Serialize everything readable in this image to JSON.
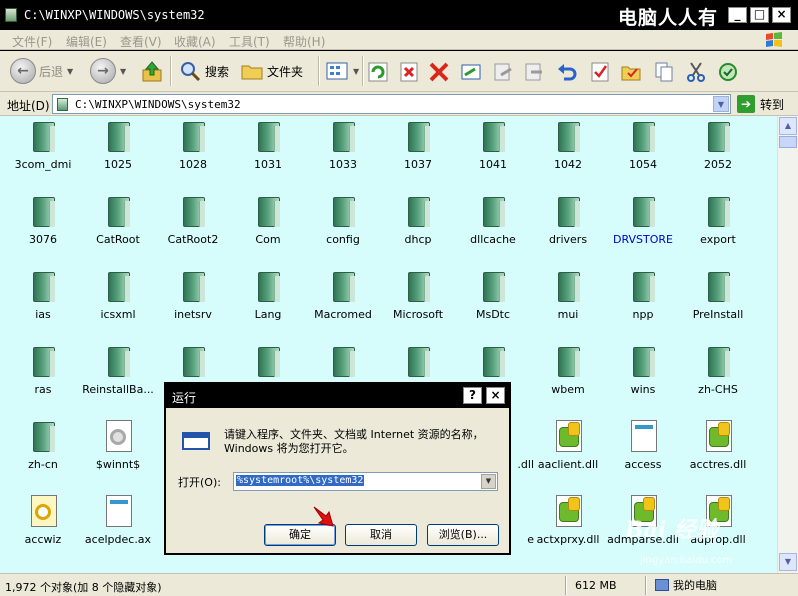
{
  "window": {
    "title": "C:\\WINXP\\WINDOWS\\system32",
    "brand_text": "电脑人人有",
    "controls": [
      "_",
      "□",
      "×"
    ]
  },
  "menu": [
    "文件(F)",
    "编辑(E)",
    "查看(V)",
    "收藏(A)",
    "工具(T)",
    "帮助(H)"
  ],
  "toolbar": {
    "back_label": "后退",
    "search_label": "搜索",
    "folders_label": "文件夹"
  },
  "address": {
    "label": "地址(D)",
    "value": "C:\\WINXP\\WINDOWS\\system32",
    "go_label": "转到"
  },
  "items": [
    {
      "name": "3com_dmi",
      "kind": "folder"
    },
    {
      "name": "1025",
      "kind": "folder"
    },
    {
      "name": "1028",
      "kind": "folder"
    },
    {
      "name": "1031",
      "kind": "folder"
    },
    {
      "name": "1033",
      "kind": "folder"
    },
    {
      "name": "1037",
      "kind": "folder"
    },
    {
      "name": "1041",
      "kind": "folder"
    },
    {
      "name": "1042",
      "kind": "folder"
    },
    {
      "name": "1054",
      "kind": "folder"
    },
    {
      "name": "2052",
      "kind": "folder"
    },
    {
      "name": "3076",
      "kind": "folder"
    },
    {
      "name": "CatRoot",
      "kind": "folder"
    },
    {
      "name": "CatRoot2",
      "kind": "folder"
    },
    {
      "name": "Com",
      "kind": "folder"
    },
    {
      "name": "config",
      "kind": "folder"
    },
    {
      "name": "dhcp",
      "kind": "folder"
    },
    {
      "name": "dllcache",
      "kind": "folder"
    },
    {
      "name": "drivers",
      "kind": "folder"
    },
    {
      "name": "DRVSTORE",
      "kind": "folder",
      "blue": true
    },
    {
      "name": "export",
      "kind": "folder"
    },
    {
      "name": "ias",
      "kind": "folder"
    },
    {
      "name": "icsxml",
      "kind": "folder"
    },
    {
      "name": "inetsrv",
      "kind": "folder"
    },
    {
      "name": "Lang",
      "kind": "folder"
    },
    {
      "name": "Macromed",
      "kind": "folder"
    },
    {
      "name": "Microsoft",
      "kind": "folder"
    },
    {
      "name": "MsDtc",
      "kind": "folder"
    },
    {
      "name": "mui",
      "kind": "folder"
    },
    {
      "name": "npp",
      "kind": "folder"
    },
    {
      "name": "PreInstall",
      "kind": "folder"
    },
    {
      "name": "ras",
      "kind": "folder"
    },
    {
      "name": "ReinstallBa...",
      "kind": "folder"
    },
    {
      "name": "",
      "kind": "folder"
    },
    {
      "name": "",
      "kind": "folder"
    },
    {
      "name": "",
      "kind": "folder"
    },
    {
      "name": "",
      "kind": "folder"
    },
    {
      "name": "",
      "kind": "folder"
    },
    {
      "name": "wbem",
      "kind": "folder"
    },
    {
      "name": "wins",
      "kind": "folder"
    },
    {
      "name": "zh-CHS",
      "kind": "folder"
    },
    {
      "name": "zh-cn",
      "kind": "folder"
    },
    {
      "name": "$winnt$",
      "kind": "gear"
    },
    {
      "name": "",
      "kind": "hidden"
    },
    {
      "name": "",
      "kind": "hidden"
    },
    {
      "name": "",
      "kind": "hidden"
    },
    {
      "name": "",
      "kind": "hidden"
    },
    {
      "name": ".dll",
      "kind": "partial"
    },
    {
      "name": "aaclient.dll",
      "kind": "dll"
    },
    {
      "name": "access",
      "kind": "doc"
    },
    {
      "name": "acctres.dll",
      "kind": "dll"
    },
    {
      "name": "accwiz",
      "kind": "wiz"
    },
    {
      "name": "acelpdec.ax",
      "kind": "doc"
    },
    {
      "name": "",
      "kind": "hidden"
    },
    {
      "name": "",
      "kind": "hidden"
    },
    {
      "name": "",
      "kind": "hidden"
    },
    {
      "name": "",
      "kind": "hidden"
    },
    {
      "name": "e",
      "kind": "partial"
    },
    {
      "name": "actxprxy.dll",
      "kind": "dll"
    },
    {
      "name": "admparse.dll",
      "kind": "dll"
    },
    {
      "name": "adprop.dll",
      "kind": "dll"
    }
  ],
  "run_dialog": {
    "title": "运行",
    "help": "?",
    "close": "×",
    "message": "请键入程序、文件夹、文档或 Internet 资源的名称，Windows 将为您打开它。",
    "open_label": "打开(O):",
    "input_value": "%systemroot%\\system32",
    "ok_label": "确定",
    "cancel_label": "取消",
    "browse_label": "浏览(B)..."
  },
  "status": {
    "count": "1,972 个对象(加 8 个隐藏对象)",
    "size": "612 MB",
    "location": "我的电脑"
  },
  "watermark": {
    "text": "Bai 经验",
    "sub": "jingyan.baidu.com"
  }
}
